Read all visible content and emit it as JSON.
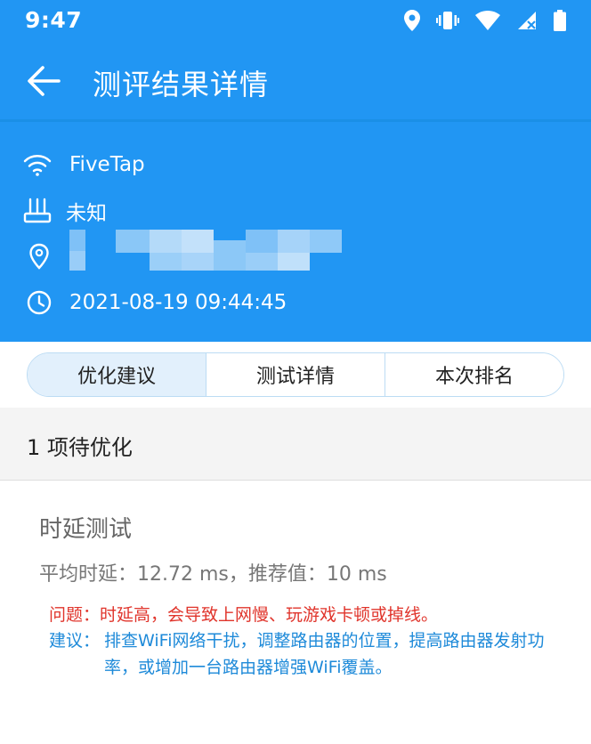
{
  "status_bar": {
    "time": "9:47",
    "icons": [
      "location-icon",
      "vibrate-icon",
      "wifi-icon",
      "cellular-no-signal-icon",
      "battery-icon"
    ]
  },
  "app_bar": {
    "title": "测评结果详情",
    "back_icon": "arrow-left-icon"
  },
  "info": {
    "wifi_name": "FiveTap",
    "router_brand": "未知",
    "location": "",
    "timestamp": "2021-08-19 09:44:45"
  },
  "tabs": [
    {
      "label": "优化建议",
      "active": true
    },
    {
      "label": "测试详情",
      "active": false
    },
    {
      "label": "本次排名",
      "active": false
    }
  ],
  "section": {
    "header": "1 项待优化"
  },
  "items": [
    {
      "name": "时延测试",
      "stat": "平均时延：12.72 ms，推荐值：10 ms",
      "problem": "问题：时延高，会导致上网慢、玩游戏卡顿或掉线。",
      "suggestion_label": "建议：",
      "suggestion": "排查WiFi网络干扰，调整路由器的位置，提高路由器发射功率，或增加一台路由器增强WiFi覆盖。"
    }
  ],
  "colors": {
    "primary": "#2196f3",
    "tab_active_bg": "#e2f0fc",
    "problem_text": "#e0342b",
    "suggestion_text": "#1e8ad9"
  }
}
